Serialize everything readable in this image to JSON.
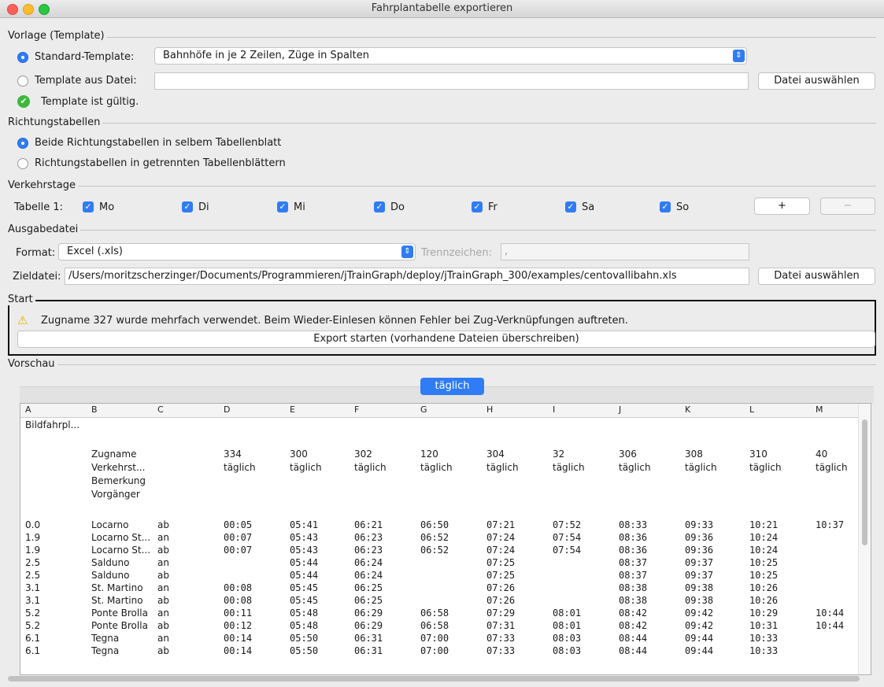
{
  "window": {
    "title": "Fahrplantabelle exportieren"
  },
  "template": {
    "label": "Vorlage (Template)",
    "standard_label": "Standard-Template:",
    "standard_value": "Bahnhöfe in je 2 Zeilen, Züge in Spalten",
    "file_label": "Template aus Datei:",
    "file_value": "",
    "choose_file": "Datei auswählen",
    "status": "Template ist gültig."
  },
  "direction": {
    "label": "Richtungstabellen",
    "option_same": "Beide Richtungstabellen in selbem Tabellenblatt",
    "option_separate": "Richtungstabellen in getrennten Tabellenblättern"
  },
  "traffic_days": {
    "label": "Verkehrstage",
    "table_label": "Tabelle 1:",
    "days": [
      "Mo",
      "Di",
      "Mi",
      "Do",
      "Fr",
      "Sa",
      "So"
    ],
    "add": "+",
    "remove": "−"
  },
  "output": {
    "label": "Ausgabedatei",
    "format_label": "Format:",
    "format_value": "Excel (.xls)",
    "separator_label": "Trennzeichen:",
    "separator_value": ",",
    "target_label": "Zieldatei:",
    "target_value": "/Users/moritzscherzinger/Documents/Programmieren/jTrainGraph/deploy/jTrainGraph_300/examples/centovallibahn.xls",
    "choose_file": "Datei auswählen"
  },
  "start": {
    "label": "Start",
    "warning": "Zugname 327 wurde mehrfach verwendet. Beim Wieder-Einlesen können Fehler bei Zug-Verknüpfungen auftreten.",
    "button": "Export starten (vorhandene Dateien überschreiben)"
  },
  "preview": {
    "label": "Vorschau",
    "tab": "täglich",
    "columns": [
      "A",
      "B",
      "C",
      "D",
      "E",
      "F",
      "G",
      "H",
      "I",
      "J",
      "K",
      "L",
      "M"
    ],
    "title_cell": "Bildfahrpl...",
    "header_labels": [
      "Zugname",
      "Verkehrst...",
      "Bemerkung",
      "Vorgänger"
    ],
    "trains": [
      {
        "name": "334",
        "days": "täglich"
      },
      {
        "name": "300",
        "days": "täglich"
      },
      {
        "name": "302",
        "days": "täglich"
      },
      {
        "name": "120",
        "days": "täglich"
      },
      {
        "name": "304",
        "days": "täglich"
      },
      {
        "name": "32",
        "days": "täglich"
      },
      {
        "name": "306",
        "days": "täglich"
      },
      {
        "name": "308",
        "days": "täglich"
      },
      {
        "name": "310",
        "days": "täglich"
      },
      {
        "name": "40",
        "days": "täglich"
      }
    ],
    "rows": [
      [
        "0.0",
        "Locarno",
        "ab",
        "00:05",
        "05:41",
        "06:21",
        "06:50",
        "07:21",
        "07:52",
        "08:33",
        "09:33",
        "10:21",
        "10:37"
      ],
      [
        "1.9",
        "Locarno St...",
        "an",
        "00:07",
        "05:43",
        "06:23",
        "06:52",
        "07:24",
        "07:54",
        "08:36",
        "09:36",
        "10:24",
        ""
      ],
      [
        "1.9",
        "Locarno St...",
        "ab",
        "00:07",
        "05:43",
        "06:23",
        "06:52",
        "07:24",
        "07:54",
        "08:36",
        "09:36",
        "10:24",
        ""
      ],
      [
        "2.5",
        "Salduno",
        "an",
        "",
        "05:44",
        "06:24",
        "",
        "07:25",
        "",
        "08:37",
        "09:37",
        "10:25",
        ""
      ],
      [
        "2.5",
        "Salduno",
        "ab",
        "",
        "05:44",
        "06:24",
        "",
        "07:25",
        "",
        "08:37",
        "09:37",
        "10:25",
        ""
      ],
      [
        "3.1",
        "St. Martino",
        "an",
        "00:08",
        "05:45",
        "06:25",
        "",
        "07:26",
        "",
        "08:38",
        "09:38",
        "10:26",
        ""
      ],
      [
        "3.1",
        "St. Martino",
        "ab",
        "00:08",
        "05:45",
        "06:25",
        "",
        "07:26",
        "",
        "08:38",
        "09:38",
        "10:26",
        ""
      ],
      [
        "5.2",
        "Ponte Brolla",
        "an",
        "00:11",
        "05:48",
        "06:29",
        "06:58",
        "07:29",
        "08:01",
        "08:42",
        "09:42",
        "10:29",
        "10:44"
      ],
      [
        "5.2",
        "Ponte Brolla",
        "ab",
        "00:12",
        "05:48",
        "06:29",
        "06:58",
        "07:31",
        "08:01",
        "08:42",
        "09:42",
        "10:31",
        "10:44"
      ],
      [
        "6.1",
        "Tegna",
        "an",
        "00:14",
        "05:50",
        "06:31",
        "07:00",
        "07:33",
        "08:03",
        "08:44",
        "09:44",
        "10:33",
        ""
      ],
      [
        "6.1",
        "Tegna",
        "ab",
        "00:14",
        "05:50",
        "06:31",
        "07:00",
        "07:33",
        "08:03",
        "08:44",
        "09:44",
        "10:33",
        ""
      ]
    ]
  }
}
